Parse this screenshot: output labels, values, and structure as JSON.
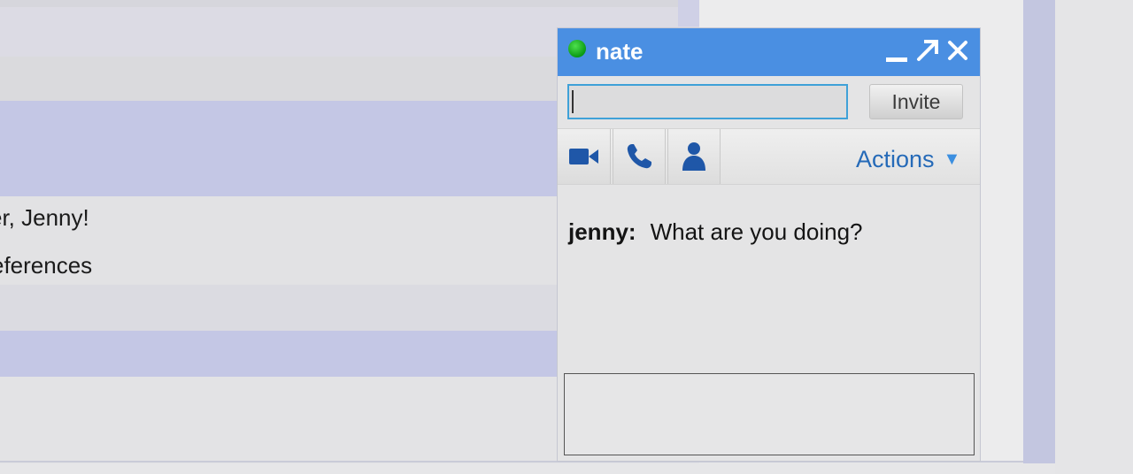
{
  "background_list": {
    "rows": [
      {
        "text": "er, Jenny!"
      },
      {
        "text": "eferences"
      }
    ]
  },
  "chat": {
    "title": "nate",
    "status": "online",
    "invite_label": "Invite",
    "invite_value": "",
    "actions_label": "Actions",
    "actions_caret": "▼",
    "close_glyph": "✕",
    "popout_glyph": "↗",
    "messages": [
      {
        "sender": "jenny:",
        "text": "What are you doing?"
      }
    ],
    "compose_value": "",
    "icons": {
      "status": "green-status-icon",
      "video": "video-camera-icon",
      "phone": "phone-icon",
      "person": "person-icon"
    }
  },
  "colors": {
    "header": "#4a8fe2",
    "status_online": "#1fb21f",
    "accent_blue": "#256ab8",
    "row_highlight": "#c4c7e5"
  }
}
